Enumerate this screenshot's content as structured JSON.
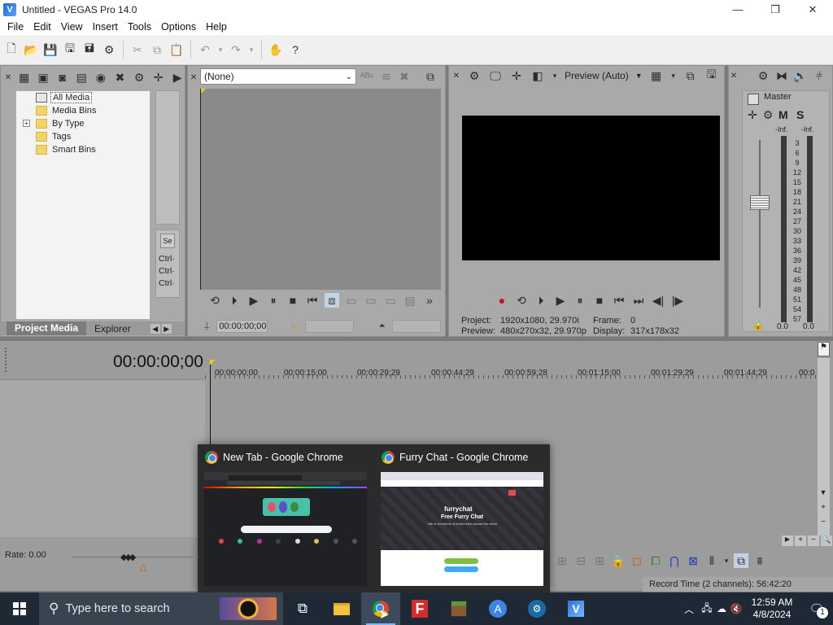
{
  "window": {
    "title": "Untitled - VEGAS Pro 14.0",
    "controls": {
      "minimize": "—",
      "maximize": "❐",
      "close": "✕"
    }
  },
  "menu": [
    "File",
    "Edit",
    "View",
    "Insert",
    "Tools",
    "Options",
    "Help"
  ],
  "project_media": {
    "tree": [
      "All Media",
      "Media Bins",
      "By Type",
      "Tags",
      "Smart Bins"
    ],
    "side_labels": [
      "Ctrl·",
      "Ctrl·",
      "Ctrl·"
    ],
    "tabs": [
      "Project Media",
      "Explorer"
    ]
  },
  "trimmer": {
    "source": "(None)",
    "timecode": "00:00:00;00"
  },
  "preview": {
    "mode": "Preview (Auto)",
    "project_label": "Project:",
    "project_value": "1920x1080, 29.970i",
    "frame_label": "Frame:",
    "frame_value": "0",
    "preview_label": "Preview:",
    "preview_value": "480x270x32, 29.970p",
    "display_label": "Display:",
    "display_value": "317x178x32"
  },
  "mixer": {
    "title": "Master",
    "m_label": "M",
    "s_label": "S",
    "peak_left": "-Inf.",
    "peak_right": "-Inf.",
    "scale": [
      "3",
      "6",
      "9",
      "12",
      "15",
      "18",
      "21",
      "24",
      "27",
      "30",
      "33",
      "36",
      "39",
      "42",
      "45",
      "48",
      "51",
      "54",
      "57"
    ],
    "level_left": "0.0",
    "level_right": "0.0"
  },
  "timeline": {
    "timecode": "00:00:00;00",
    "ruler": [
      "00:00:00;00",
      "00:00:15;00",
      "00:00:29;29",
      "00:00:44;29",
      "00:00:59;28",
      "00:01:15;00",
      "00:01:29;29",
      "00:01:44;29",
      "00:0"
    ],
    "rate": "Rate: 0.00"
  },
  "status": {
    "record_time": "Record Time (2 channels): 56:42:20"
  },
  "taskbar_popup": {
    "window1_title": "New Tab - Google Chrome",
    "window2_title": "Furry Chat - Google Chrome",
    "thumb2_heading": "Free Furry Chat",
    "thumb2_sub": "Talk to hundreds of furries from across the world",
    "thumb2_logo": "furrychat"
  },
  "taskbar": {
    "search_placeholder": "Type here to search",
    "time": "12:59 AM",
    "date": "4/8/2024",
    "notification_count": "1"
  }
}
